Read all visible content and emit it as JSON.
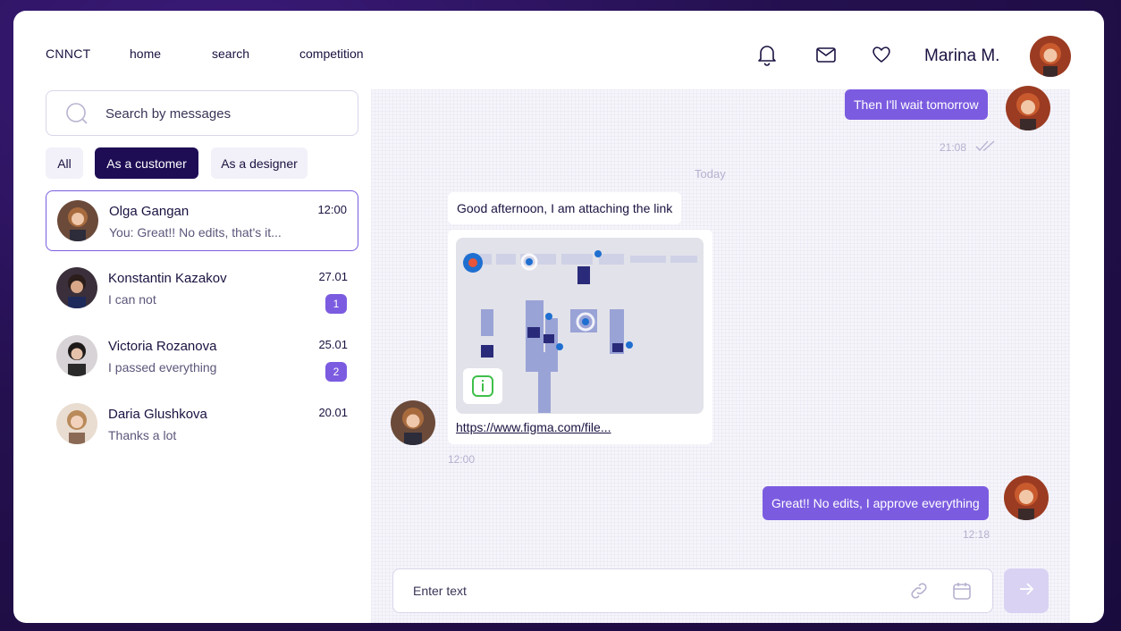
{
  "header": {
    "logo": "CNNCT",
    "nav": [
      "home",
      "search",
      "competition"
    ],
    "user_name": "Marina M.",
    "icons": [
      "bell-icon",
      "mail-icon",
      "heart-icon"
    ]
  },
  "search": {
    "placeholder": "Search by messages"
  },
  "filters": [
    {
      "label": "All",
      "active": false
    },
    {
      "label": "As a customer",
      "active": true
    },
    {
      "label": "As a designer",
      "active": false
    }
  ],
  "conversations": [
    {
      "name": "Olga Gangan",
      "preview": "You: Great!! No edits, that's it...",
      "time": "12:00",
      "unread": "",
      "selected": true
    },
    {
      "name": "Konstantin Kazakov",
      "preview": "I can not",
      "time": "27.01",
      "unread": "1",
      "selected": false
    },
    {
      "name": "Victoria Rozanova",
      "preview": "I passed everything",
      "time": "25.01",
      "unread": "2",
      "selected": false
    },
    {
      "name": "Daria Glushkova",
      "preview": "Thanks a lot",
      "time": "20.01",
      "unread": "",
      "selected": false
    }
  ],
  "chat": {
    "messages": [
      {
        "direction": "out",
        "text": "Then I'll wait tomorrow",
        "time": "21:08"
      },
      {
        "direction": "in",
        "text": "Good afternoon, I am attaching the link"
      },
      {
        "direction": "in",
        "type": "link",
        "url": "https://www.figma.com/file...",
        "time": "12:00"
      },
      {
        "direction": "out",
        "text": "Great!! No edits, I approve everything",
        "time": "12:18"
      }
    ],
    "date_separator": "Today",
    "input_placeholder": "Enter text"
  },
  "colors": {
    "accent": "#7b5ce0",
    "dark": "#1e0d55",
    "background": "#24104f"
  }
}
